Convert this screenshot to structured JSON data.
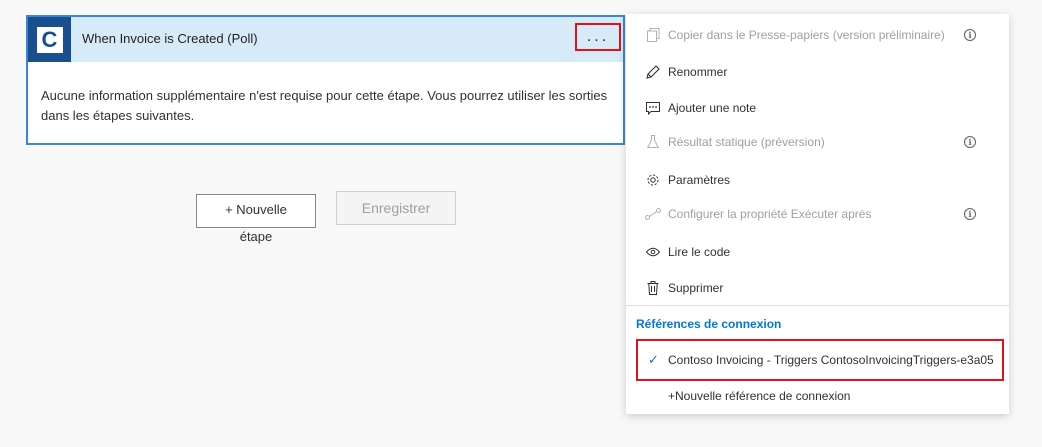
{
  "card": {
    "icon_letter": "C",
    "title": "When Invoice is Created (Poll)",
    "more_label": "...",
    "body": "Aucune information supplémentaire n'est requise pour cette étape. Vous pourrez utiliser les sorties dans les étapes suivantes."
  },
  "actions": {
    "new_step_line1": "+ Nouvelle",
    "new_step_line2": "étape",
    "save_label": "Enregistrer"
  },
  "menu": {
    "items": [
      {
        "label": "Copier dans le Presse-papiers (version préliminaire)",
        "icon": "copy-icon",
        "disabled": true,
        "info": true
      },
      {
        "label": "Renommer",
        "icon": "pencil-icon",
        "disabled": false,
        "info": false
      },
      {
        "label": "Ajouter une note",
        "icon": "comment-icon",
        "disabled": false,
        "info": false
      },
      {
        "label": "Résultat statique (préversion)",
        "icon": "flask-icon",
        "disabled": true,
        "info": true
      },
      {
        "label": "Paramètres",
        "icon": "gear-icon",
        "disabled": false,
        "info": false
      },
      {
        "label": "Configurer la propriété Exécuter après",
        "icon": "run-after-icon",
        "disabled": true,
        "info": true
      },
      {
        "label": "Lire le code",
        "icon": "eye-icon",
        "disabled": false,
        "info": false
      },
      {
        "label": "Supprimer",
        "icon": "trash-icon",
        "disabled": false,
        "info": false
      }
    ],
    "section_header": "Références de connexion",
    "connection_label": "Contoso Invoicing - Triggers ContosoInvoicingTriggers-e3a05",
    "new_connection_label": "+Nouvelle référence de connexion"
  },
  "colors": {
    "card_border": "#3a86d6",
    "header_bg": "#d6eaf8",
    "icon_bg": "#1a4f8f",
    "highlight_red": "#e0121b",
    "accent_blue": "#0078d4"
  }
}
